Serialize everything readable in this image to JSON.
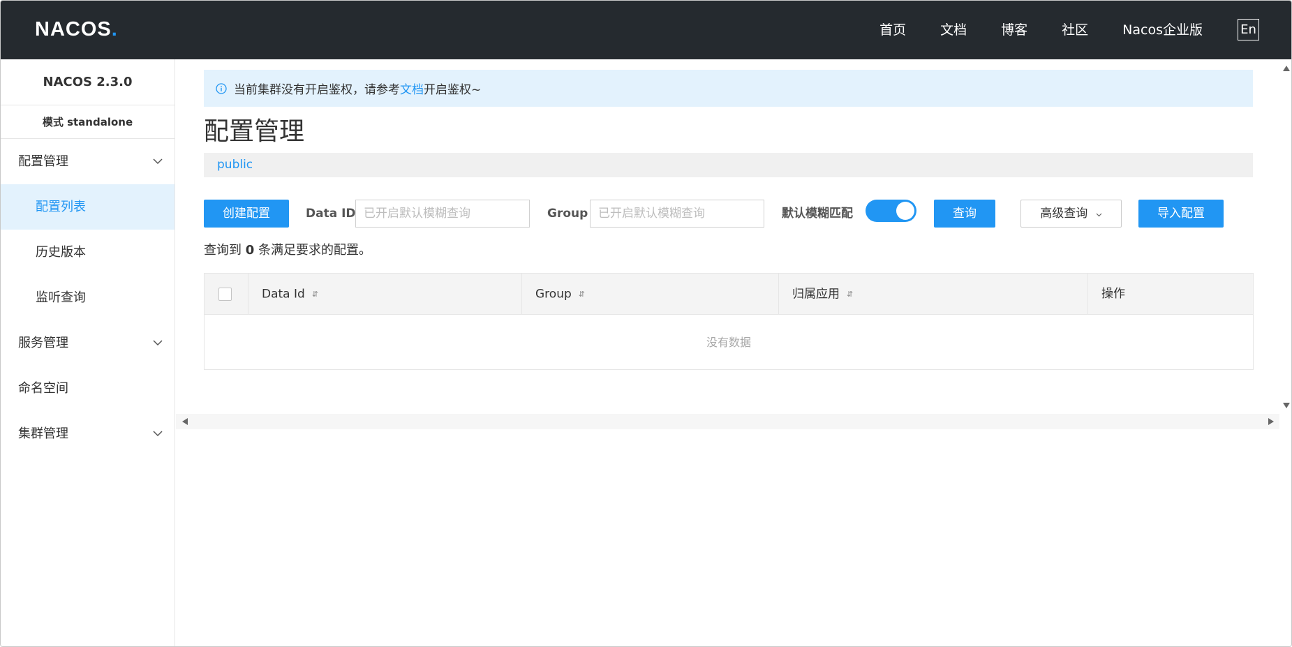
{
  "header": {
    "logo_text": "NACOS",
    "logo_dot": ".",
    "nav": [
      "首页",
      "文档",
      "博客",
      "社区",
      "Nacos企业版"
    ],
    "lang_button": "En"
  },
  "sidebar": {
    "version": "NACOS 2.3.0",
    "mode": "模式 standalone",
    "items": [
      {
        "label": "配置管理",
        "type": "group",
        "expanded": true
      },
      {
        "label": "配置列表",
        "type": "sub",
        "active": true
      },
      {
        "label": "历史版本",
        "type": "sub"
      },
      {
        "label": "监听查询",
        "type": "sub"
      },
      {
        "label": "服务管理",
        "type": "group"
      },
      {
        "label": "命名空间",
        "type": "item"
      },
      {
        "label": "集群管理",
        "type": "group"
      }
    ]
  },
  "alert": {
    "icon": "info-icon",
    "prefix": "当前集群没有开启鉴权，请参考",
    "link": "文档",
    "suffix": "开启鉴权~"
  },
  "page": {
    "title": "配置管理",
    "namespace": "public"
  },
  "toolbar": {
    "create_label": "创建配置",
    "data_id_label": "Data ID",
    "data_id_placeholder": "已开启默认模糊查询",
    "group_label": "Group",
    "group_placeholder": "已开启默认模糊查询",
    "fuzzy_label": "默认模糊匹配",
    "fuzzy_enabled": true,
    "query_label": "查询",
    "advanced_label": "高级查询",
    "import_label": "导入配置"
  },
  "result": {
    "prefix": "查询到",
    "count": "0",
    "suffix": "条满足要求的配置。"
  },
  "table": {
    "columns": [
      "Data Id",
      "Group",
      "归属应用",
      "操作"
    ],
    "sort_icon": "⇵",
    "empty_text": "没有数据"
  },
  "colors": {
    "primary": "#2196f3",
    "header_bg": "#252a2f",
    "alert_bg": "#e3f2fd"
  }
}
